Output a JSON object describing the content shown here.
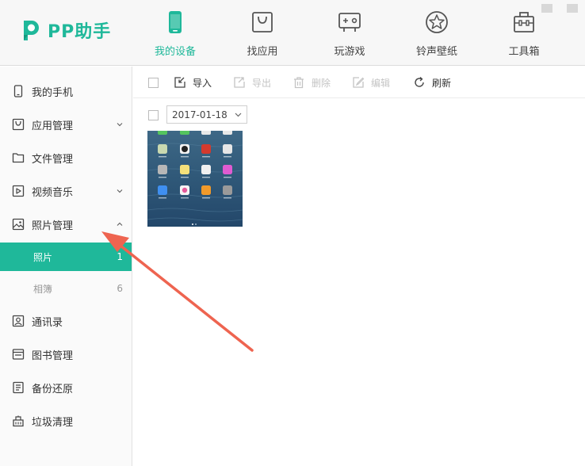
{
  "app": {
    "logo_text": "PP助手"
  },
  "nav": [
    {
      "label": "我的设备",
      "icon": "phone-icon",
      "active": true
    },
    {
      "label": "找应用",
      "icon": "app-bag-icon",
      "active": false
    },
    {
      "label": "玩游戏",
      "icon": "gamepad-icon",
      "active": false
    },
    {
      "label": "铃声壁纸",
      "icon": "star-icon",
      "active": false
    },
    {
      "label": "工具箱",
      "icon": "toolbox-icon",
      "active": false
    }
  ],
  "sidebar": {
    "items": [
      {
        "label": "我的手机",
        "icon": "phone-icon"
      },
      {
        "label": "应用管理",
        "icon": "app-bag-icon",
        "expand": "down"
      },
      {
        "label": "文件管理",
        "icon": "folder-icon"
      },
      {
        "label": "视频音乐",
        "icon": "play-icon",
        "expand": "down"
      },
      {
        "label": "照片管理",
        "icon": "image-icon",
        "expand": "up"
      },
      {
        "label": "通讯录",
        "icon": "contacts-icon"
      },
      {
        "label": "图书管理",
        "icon": "book-icon"
      },
      {
        "label": "备份还原",
        "icon": "backup-icon"
      },
      {
        "label": "垃圾清理",
        "icon": "trash-clean-icon"
      }
    ],
    "sub_items": [
      {
        "label": "照片",
        "count": "1",
        "active": true
      },
      {
        "label": "相簿",
        "count": "6",
        "active": false
      }
    ]
  },
  "toolbar": {
    "import_label": "导入",
    "export_label": "导出",
    "delete_label": "删除",
    "edit_label": "编辑",
    "refresh_label": "刷新"
  },
  "content": {
    "date_group": "2017-01-18"
  },
  "colors": {
    "accent": "#1fb89a",
    "arrow": "#ee6450"
  }
}
